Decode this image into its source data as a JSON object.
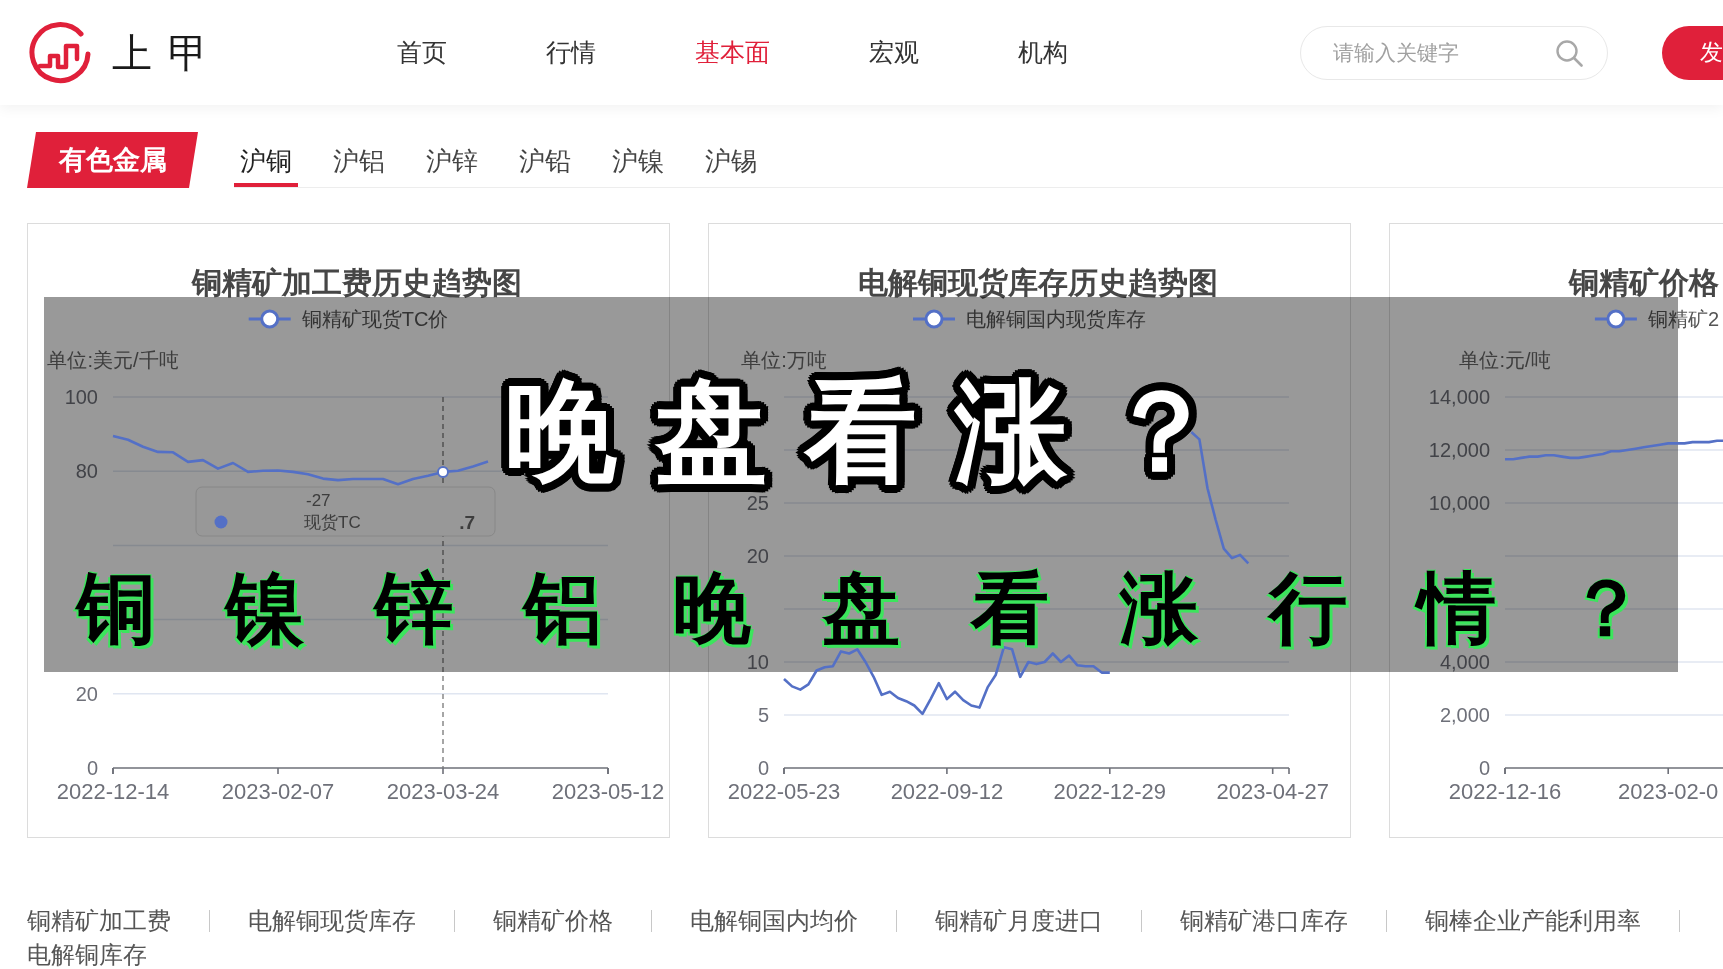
{
  "header": {
    "logo_text": "上甲",
    "nav": [
      {
        "label": "首页",
        "selected": false
      },
      {
        "label": "行情",
        "selected": false
      },
      {
        "label": "基本面",
        "selected": true
      },
      {
        "label": "宏观",
        "selected": false
      },
      {
        "label": "机构",
        "selected": false
      }
    ],
    "search": {
      "placeholder": "请输入关键字"
    },
    "button": "发"
  },
  "category": {
    "badge": "有色金属",
    "tabs": [
      {
        "label": "沪铜",
        "selected": true
      },
      {
        "label": "沪铝",
        "selected": false
      },
      {
        "label": "沪锌",
        "selected": false
      },
      {
        "label": "沪铅",
        "selected": false
      },
      {
        "label": "沪镍",
        "selected": false
      },
      {
        "label": "沪锡",
        "selected": false
      }
    ]
  },
  "charts": [
    {
      "chart_data": {
        "type": "line",
        "title": "铜精矿加工费历史趋势图",
        "ylabel": "单位:美元/千吨",
        "grid": true,
        "categories": [
          "2022-12-14",
          null,
          null,
          null,
          null,
          null,
          null,
          null,
          null,
          null,
          null,
          "2023-02-07",
          null,
          null,
          null,
          null,
          null,
          null,
          null,
          null,
          null,
          null,
          "2023-03-24",
          null,
          null,
          null,
          null,
          null,
          null,
          null,
          null,
          null,
          null,
          "2023-05-12"
        ],
        "series": [
          {
            "name": "铜精矿现货TC价",
            "color": "#5470c6",
            "values": [
              89.5,
              88.5,
              86.6,
              85.2,
              85.1,
              82.5,
              83.0,
              80.7,
              82.2,
              79.8,
              80.1,
              80.2,
              79.8,
              79.2,
              78.0,
              77.6,
              77.9,
              77.9,
              77.9,
              76.5,
              77.9,
              78.8,
              79.8,
              80.1,
              81.3,
              82.6,
              null,
              null,
              null,
              null,
              null,
              null,
              null,
              null
            ]
          }
        ],
        "ylim": [
          0,
          100
        ],
        "yticks": [
          0,
          20,
          80,
          100
        ]
      },
      "tooltip": {
        "title": "-27",
        "label": "现货TC",
        "value": ".7"
      }
    },
    {
      "chart_data": {
        "type": "line",
        "title": "电解铜现货库存历史趋势图",
        "ylabel": "单位:万吨",
        "grid": true,
        "categories": [
          "2022-05-23",
          null,
          null,
          null,
          null,
          null,
          null,
          null,
          null,
          null,
          null,
          null,
          null,
          null,
          null,
          null,
          null,
          null,
          null,
          null,
          "2022-09-12",
          null,
          null,
          null,
          null,
          null,
          null,
          null,
          null,
          null,
          null,
          null,
          null,
          null,
          null,
          null,
          null,
          null,
          null,
          null,
          "2022-12-29",
          null,
          null,
          null,
          null,
          null,
          null,
          null,
          null,
          null,
          null,
          null,
          null,
          null,
          null,
          null,
          null,
          null,
          null,
          null,
          "2023-04-27",
          null,
          null
        ],
        "series": [
          {
            "name": "电解铜国内现货库存",
            "color": "#5470c6",
            "values": [
              8.4,
              7.7,
              7.4,
              7.9,
              9.2,
              9.5,
              9.6,
              11.0,
              10.8,
              11.2,
              10.0,
              8.6,
              6.9,
              7.2,
              6.6,
              6.3,
              5.9,
              5.1,
              6.5,
              8.0,
              6.5,
              7.2,
              6.4,
              5.9,
              5.7,
              7.6,
              8.8,
              11.4,
              11.2,
              8.6,
              10.0,
              9.8,
              10.0,
              10.8,
              10.0,
              10.6,
              9.7,
              9.6,
              9.6,
              9.0,
              9.0,
              null,
              null,
              null,
              null,
              null,
              null,
              null,
              null,
              null,
              31.7,
              31.0,
              26.4,
              23.4,
              20.7,
              19.8,
              20.1,
              19.3,
              null,
              null,
              null,
              null,
              null
            ]
          }
        ],
        "ylim": [
          0,
          35
        ],
        "yticks": [
          0,
          5,
          10,
          20,
          25
        ]
      }
    },
    {
      "chart_data": {
        "type": "line",
        "title": "铜精矿价格",
        "ylabel": "单位:元/吨",
        "grid": true,
        "categories": [
          "2022-12-16",
          null,
          null,
          null,
          null,
          null,
          null,
          null,
          null,
          null,
          null,
          null,
          null,
          null,
          null,
          null,
          null,
          null,
          null,
          null,
          "2023-02-0",
          null,
          null,
          null,
          null,
          null,
          null,
          null,
          null,
          null,
          null,
          null,
          null,
          null,
          null,
          null,
          null,
          null,
          null,
          null,
          null,
          null,
          null,
          null,
          null,
          null,
          null,
          null,
          null,
          null,
          null,
          null,
          null,
          null,
          null,
          null,
          null,
          null
        ],
        "series": [
          {
            "name": "铜精矿2",
            "color": "#5470c6",
            "values": [
              11650,
              11650,
              11700,
              11750,
              11750,
              11800,
              11800,
              11750,
              11700,
              11700,
              11750,
              11800,
              11850,
              11950,
              11950,
              12000,
              12050,
              12100,
              12150,
              12200,
              12250,
              12250,
              12250,
              12300,
              12300,
              12300,
              12350,
              12350,
              null,
              null,
              null,
              null,
              null,
              null,
              null,
              null,
              null,
              null,
              null,
              null,
              null,
              null,
              null,
              null,
              null,
              null,
              null,
              null,
              null,
              null,
              null,
              null,
              null,
              null,
              null,
              null,
              null,
              null
            ]
          }
        ],
        "ylim": [
          0,
          14000
        ],
        "yticks": [
          {
            "value": 0,
            "label": "0"
          },
          {
            "value": 2000,
            "label": "2,000"
          },
          {
            "value": 4000,
            "label": "4,000"
          },
          {
            "value": 10000,
            "label": "10,000"
          },
          {
            "value": 12000,
            "label": "12,000"
          },
          {
            "value": 14000,
            "label": "14,000"
          }
        ]
      }
    }
  ],
  "links": [
    "铜精矿加工费",
    "电解铜现货库存",
    "铜精矿价格",
    "电解铜国内均价",
    "铜精矿月度进口",
    "铜精矿港口库存",
    "铜棒企业产能利用率",
    "电解铜库存"
  ],
  "overlay": {
    "headline": "晚盘看涨？",
    "subline": "铜镍锌铝晚盘看涨行情？"
  }
}
